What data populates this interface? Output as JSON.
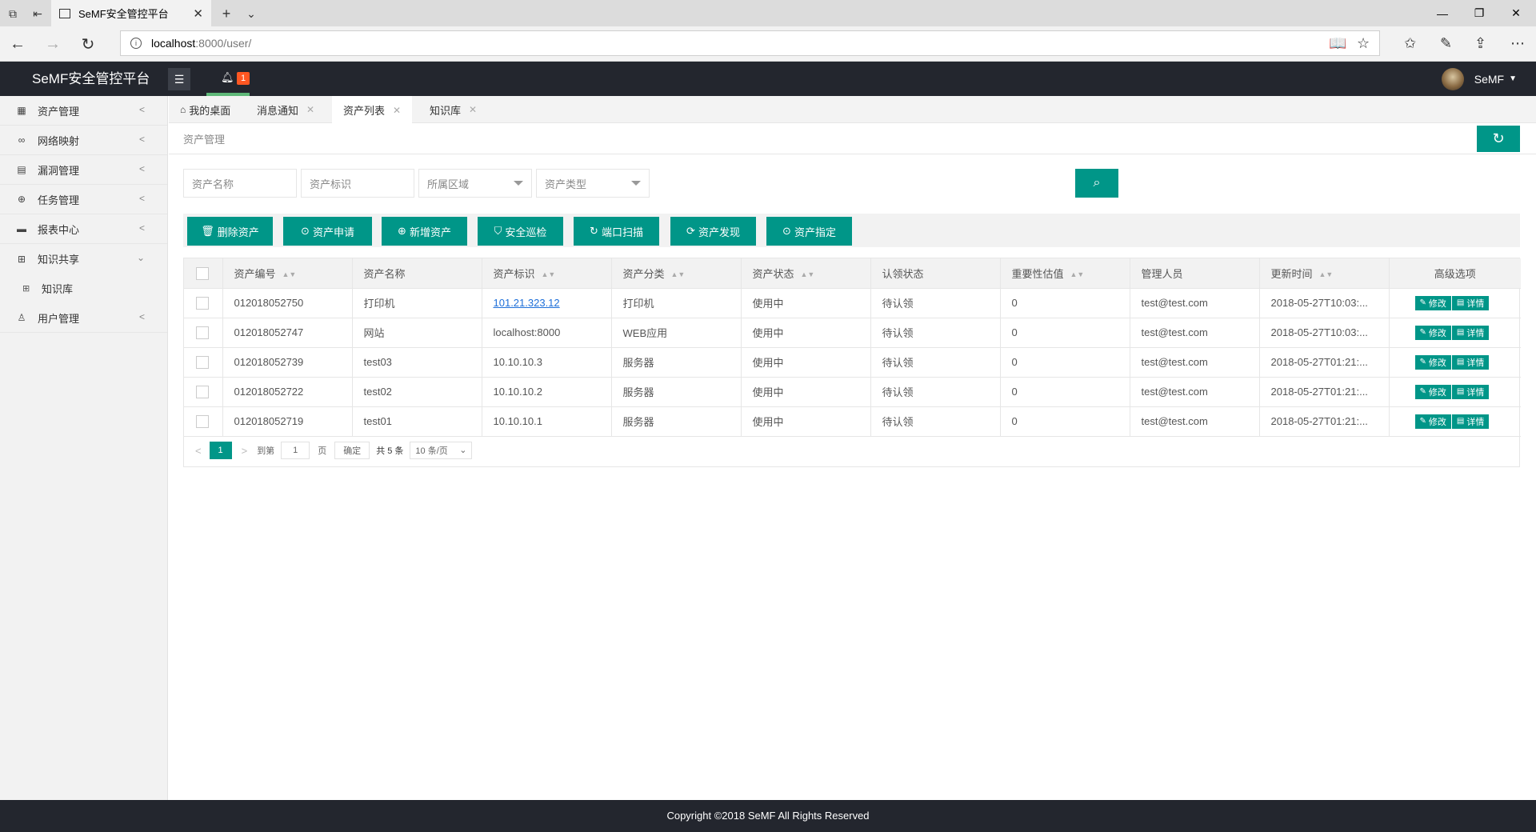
{
  "browser": {
    "tab_title": "SeMF安全管控平台",
    "url_host": "localhost",
    "url_path": ":8000/user/"
  },
  "header": {
    "logo": "SeMF安全管控平台",
    "notification_count": "1",
    "username": "SeMF"
  },
  "sidebar": {
    "items": [
      {
        "label": "资产管理",
        "icon": "asset-icon"
      },
      {
        "label": "网络映射",
        "icon": "link-icon"
      },
      {
        "label": "漏洞管理",
        "icon": "bug-icon"
      },
      {
        "label": "任务管理",
        "icon": "task-icon"
      },
      {
        "label": "报表中心",
        "icon": "report-icon"
      },
      {
        "label": "知识共享",
        "icon": "book-icon"
      },
      {
        "label": "用户管理",
        "icon": "user-icon"
      }
    ],
    "sub_items": [
      {
        "label": "知识库"
      }
    ]
  },
  "page_tabs": [
    {
      "label": "我的桌面"
    },
    {
      "label": "消息通知"
    },
    {
      "label": "资产列表"
    },
    {
      "label": "知识库"
    }
  ],
  "breadcrumb": "资产管理",
  "filters": {
    "asset_name": "资产名称",
    "asset_id": "资产标识",
    "area": "所属区域",
    "asset_type": "资产类型"
  },
  "toolbar": {
    "delete": "删除资产",
    "apply": "资产申请",
    "add": "新增资产",
    "inspect": "安全巡检",
    "port_scan": "端口扫描",
    "discover": "资产发现",
    "assign": "资产指定"
  },
  "table": {
    "columns": [
      "资产编号",
      "资产名称",
      "资产标识",
      "资产分类",
      "资产状态",
      "认领状态",
      "重要性估值",
      "管理人员",
      "更新时间",
      "高级选项"
    ],
    "rows": [
      [
        "012018052750",
        "打印机",
        "101.21.323.12",
        "打印机",
        "使用中",
        "待认领",
        "0",
        "test@test.com",
        "2018-05-27T10:03:..."
      ],
      [
        "012018052747",
        "网站",
        "localhost:8000",
        "WEB应用",
        "使用中",
        "待认领",
        "0",
        "test@test.com",
        "2018-05-27T10:03:..."
      ],
      [
        "012018052739",
        "test03",
        "10.10.10.3",
        "服务器",
        "使用中",
        "待认领",
        "0",
        "test@test.com",
        "2018-05-27T01:21:..."
      ],
      [
        "012018052722",
        "test02",
        "10.10.10.2",
        "服务器",
        "使用中",
        "待认领",
        "0",
        "test@test.com",
        "2018-05-27T01:21:..."
      ],
      [
        "012018052719",
        "test01",
        "10.10.10.1",
        "服务器",
        "使用中",
        "待认领",
        "0",
        "test@test.com",
        "2018-05-27T01:21:..."
      ]
    ],
    "edit_label": "修改",
    "detail_label": "详情"
  },
  "pager": {
    "current": "1",
    "goto": "到第",
    "page_input": "1",
    "page_unit": "页",
    "confirm": "确定",
    "total": "共 5 条",
    "per_page": "10 条/页"
  },
  "footer": "Copyright ©2018 SeMF All Rights Reserved",
  "colors": {
    "accent": "#009688",
    "header": "#23262e",
    "badge": "#ff5722"
  }
}
